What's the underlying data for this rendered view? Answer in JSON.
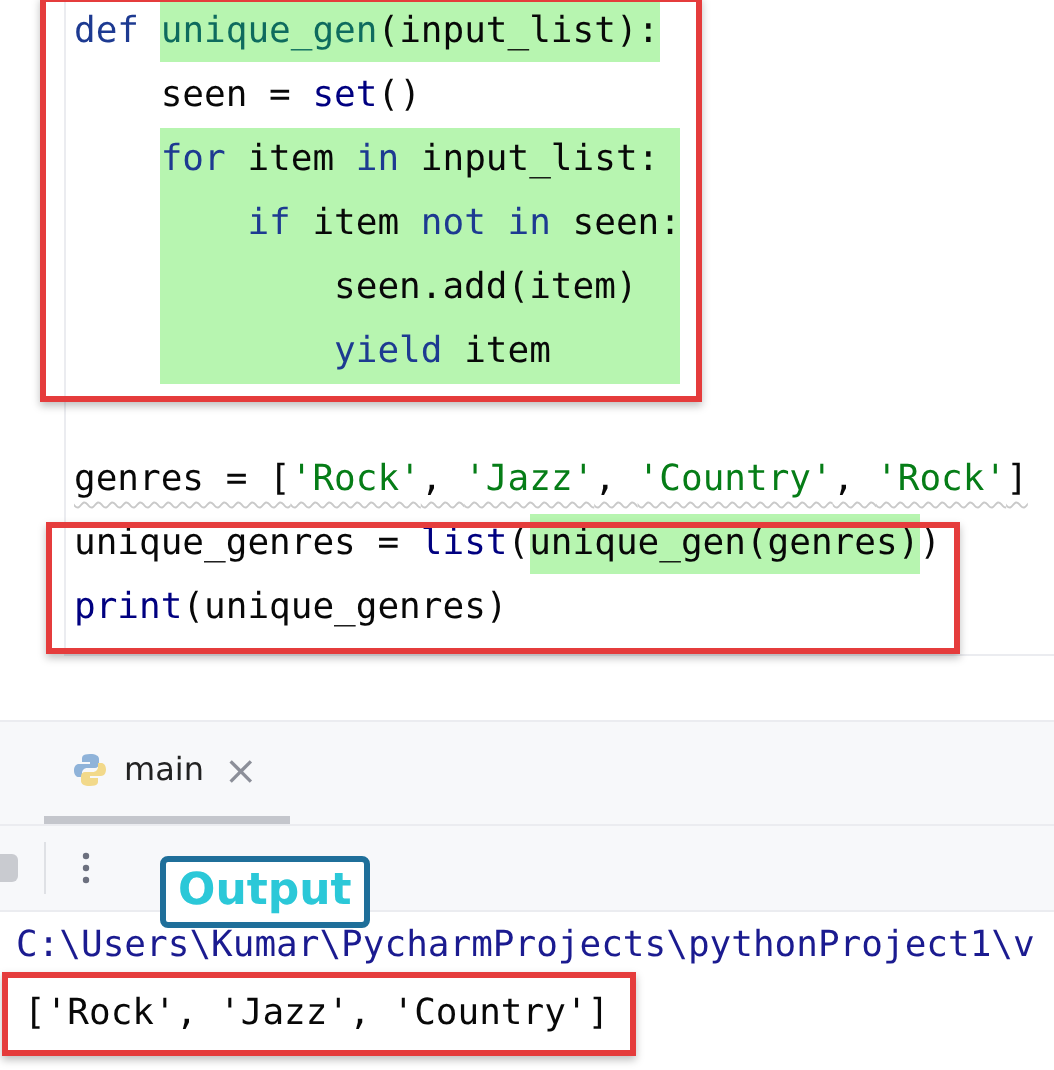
{
  "editor": {
    "lines": [
      {
        "kind": "code",
        "segments": [
          {
            "text": "def ",
            "kind": "keyword",
            "highlighted": false
          },
          {
            "text": "unique_gen",
            "kind": "function",
            "highlighted": true
          },
          {
            "text": "(input_list):",
            "kind": "plain",
            "highlighted": true
          }
        ]
      },
      {
        "kind": "code",
        "segments": [
          {
            "text": "    seen = ",
            "kind": "plain",
            "highlighted": false
          },
          {
            "text": "set",
            "kind": "builtin",
            "highlighted": false
          },
          {
            "text": "()",
            "kind": "plain",
            "highlighted": false
          }
        ]
      },
      {
        "kind": "highlighted_block",
        "segments": [
          {
            "text": "for",
            "kind": "keyword"
          },
          {
            "text": " item ",
            "kind": "plain"
          },
          {
            "text": "in",
            "kind": "keyword"
          },
          {
            "text": " input_list:",
            "kind": "plain"
          }
        ]
      },
      {
        "kind": "highlighted_block",
        "segments": [
          {
            "text": "    if",
            "kind": "keyword"
          },
          {
            "text": " item ",
            "kind": "plain"
          },
          {
            "text": "not",
            "kind": "keyword"
          },
          {
            "text": " in",
            "kind": "keyword"
          },
          {
            "text": " seen:",
            "kind": "plain"
          }
        ]
      },
      {
        "kind": "highlighted_block",
        "segments": [
          {
            "text": "        seen.add(item)",
            "kind": "plain"
          }
        ]
      },
      {
        "kind": "highlighted_block",
        "segments": [
          {
            "text": "        yield",
            "kind": "keyword"
          },
          {
            "text": " item",
            "kind": "plain"
          }
        ]
      },
      {
        "kind": "blank"
      },
      {
        "kind": "code",
        "warning": true,
        "segments": [
          {
            "text": "genres = [",
            "kind": "plain",
            "highlighted": false
          },
          {
            "text": "'Rock'",
            "kind": "string",
            "highlighted": false
          },
          {
            "text": ", ",
            "kind": "plain",
            "highlighted": false
          },
          {
            "text": "'Jazz'",
            "kind": "string",
            "highlighted": false
          },
          {
            "text": ", ",
            "kind": "plain",
            "highlighted": false
          },
          {
            "text": "'Country'",
            "kind": "string",
            "highlighted": false
          },
          {
            "text": ", ",
            "kind": "plain",
            "highlighted": false
          },
          {
            "text": "'Rock'",
            "kind": "string",
            "highlighted": false
          },
          {
            "text": "]",
            "kind": "plain",
            "highlighted": false
          }
        ]
      },
      {
        "kind": "code",
        "segments": [
          {
            "text": "unique_genres = ",
            "kind": "plain",
            "highlighted": false
          },
          {
            "text": "list",
            "kind": "builtin",
            "highlighted": false
          },
          {
            "text": "(",
            "kind": "plain",
            "highlighted": false
          },
          {
            "text": "unique_gen(genres)",
            "kind": "plain",
            "highlighted": true
          },
          {
            "text": ")",
            "kind": "plain",
            "highlighted": false
          }
        ]
      },
      {
        "kind": "code",
        "segments": [
          {
            "text": "print",
            "kind": "builtin",
            "highlighted": false
          },
          {
            "text": "(unique_genres)",
            "kind": "plain",
            "highlighted": false
          }
        ]
      }
    ]
  },
  "run_panel": {
    "tabs": [
      {
        "label": "main",
        "close": "×",
        "selected": true
      }
    ],
    "console": [
      {
        "kind": "command",
        "text": "C:\\Users\\Kumar\\PycharmProjects\\pythonProject1\\v"
      },
      {
        "kind": "output",
        "text": "['Rock', 'Jazz', 'Country']"
      }
    ]
  },
  "callout": {
    "text": "Output"
  }
}
